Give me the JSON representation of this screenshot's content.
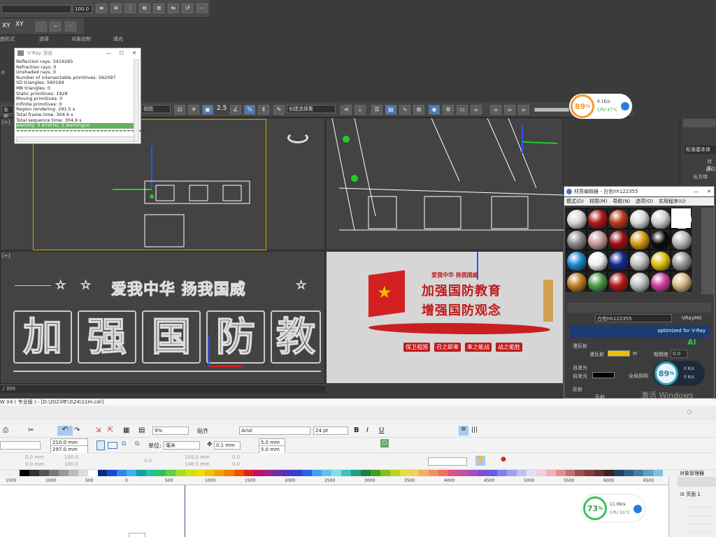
{
  "max": {
    "top_combo_value": "",
    "top_num": "100.0",
    "xy_label": "XY",
    "xy2_label": "XY",
    "row3_labels": [
      "曲形式",
      "选择",
      "对象绘制",
      "填充"
    ],
    "viewport_combo": "视图",
    "percent_num": "2.5",
    "selection_set": "创建选择集",
    "left_zero": "0",
    "full_label": "全部",
    "frame_counter": "/ 300",
    "viewport_left_labels": [
      "[+]",
      "[+]"
    ],
    "china_text": "爱我中华 扬我国威",
    "big_chars": [
      "加",
      "强",
      "国",
      "防",
      "教"
    ],
    "right_panel": {
      "std_label": "标准基本体",
      "obj_label": "对象",
      "auto_label": "自动",
      "box_label": "长方体"
    }
  },
  "vray": {
    "title": "V-Ray 消息",
    "lines": [
      "Reflection rays: 3419265",
      "Refraction rays: 0",
      "Unshaded rays: 0",
      "Number of intersectable primitives: 562097",
      "SD triangles: 560169",
      "MB triangles: 0",
      "Static primitives: 1928",
      "Moving primitives: 0",
      "Infinite primitives: 0",
      "Region rendering: 291.5 s",
      "Total frame time: 304.6 s",
      "Total sequence time: 304.9 s"
    ],
    "warning": "warning: 0 error(s), 2 warning(s)",
    "separator": "=================================="
  },
  "mat_editor": {
    "title": "材质编辑器 - 白色hh122355",
    "menu": [
      "模式(D)",
      "材质(M)",
      "导航(N)",
      "选项(O)",
      "实用程序(U)"
    ],
    "mat_name": "白色hh122355",
    "mat_type": "VRayMtl",
    "vray_banner": "optimized for V-Ray",
    "diffuse_section": "漫反射",
    "diffuse_label": "漫反射",
    "roughness_label": "粗糙度",
    "roughness_val": "0.0",
    "self_illum_section": "自发光",
    "self_illum_label": "自发光",
    "gi_label": "全局照明",
    "reflect_section": "反射",
    "reflect_label": "反射",
    "activate": "激活 Windows",
    "spheres": [
      "#d8d8d8",
      "#b01818",
      "#b83a1a",
      "#d8d8d8",
      "#d0d0d0",
      "#ffffff",
      "#8a8a8a",
      "#c89a9a",
      "#a01010",
      "#d89a10",
      "#0a0a0a",
      "#b8b8b8",
      "#1a8ad0",
      "#f0f0f0",
      "#102a90",
      "#c0c0c0",
      "#e0c010",
      "#9a9a9a",
      "#c08020",
      "#4a9a4a",
      "#b81818",
      "#c0c0c0",
      "#d040a0",
      "#d8b880"
    ],
    "ai_badge": "AI"
  },
  "monitor_top": {
    "percent": "89",
    "unit": "%",
    "net": "9.1K/s",
    "cpu": "CPU 47°C"
  },
  "monitor_mid": {
    "percent": "89",
    "unit": "%",
    "up": "0 K/s",
    "down": "0 K/s"
  },
  "monitor_bot": {
    "percent": "73",
    "unit": "%",
    "net": "11.0K/s",
    "cpu": "CPU 55°C"
  },
  "render": {
    "slogan_small": "爱我中华 扬我国威",
    "line1": "加强国防教育",
    "line2": "增强国防观念",
    "tags": [
      "保卫祖国",
      "召之即来",
      "来之能战",
      "战之能胜"
    ]
  },
  "corel": {
    "title": "W X4 ( 专业版 ) - [D:\\2023年\\3\\24\\11m.cdr]",
    "zoom": "9%",
    "paste_label": "贴齐",
    "font": "Arial",
    "font_size": "24 pt",
    "width": "210.0 mm",
    "height": "297.0 mm",
    "unit_label": "单位:",
    "unit": "毫米",
    "nudge": "0.1 mm",
    "dup_x": "5.0 mm",
    "dup_y": "5.0 mm",
    "pos_x": "0.0 mm",
    "pos_y": "0.0 mm",
    "scale_x": "100.0",
    "scale_y": "100.0",
    "angle": "0.0",
    "size2_x": "105.0 mm",
    "size2_y": "148.5 mm",
    "small0a": "0.0",
    "small0b": "0.0",
    "obj_manager": "对象管理器",
    "page1": "页面 1",
    "ruler": [
      "1500",
      "1000",
      "500",
      "0",
      "500",
      "1000",
      "1500",
      "2000",
      "2500",
      "3000",
      "3500",
      "4000",
      "4500",
      "5000",
      "5500",
      "6000",
      "6500"
    ]
  },
  "palette": [
    "#000000",
    "#333333",
    "#555555",
    "#777777",
    "#999999",
    "#bbbbbb",
    "#dddddd",
    "#ffffff",
    "#0a2a8a",
    "#1a4ad0",
    "#2a8ae0",
    "#40b0f0",
    "#10a0a0",
    "#20c0a0",
    "#30c060",
    "#60d040",
    "#a0e020",
    "#d0e010",
    "#f0e000",
    "#f0c000",
    "#f0a000",
    "#f08000",
    "#f05000",
    "#e02020",
    "#c01060",
    "#a02090",
    "#7030a0",
    "#5030c0",
    "#3040d0",
    "#3060e0",
    "#40a0f0",
    "#60c0f0",
    "#80e0e0",
    "#40c0c0",
    "#20a080",
    "#208040",
    "#40a020",
    "#80c020",
    "#c0d020",
    "#e0e040",
    "#f0d060",
    "#f0b060",
    "#f09060",
    "#f07060",
    "#e05080",
    "#c050a0",
    "#a050c0",
    "#8050d0",
    "#6060e0",
    "#8080f0",
    "#a0a0f0",
    "#c0c0f0",
    "#e0e0f8",
    "#f0d0e0",
    "#f0b0c0",
    "#e09090",
    "#c07070",
    "#a05050",
    "#804040",
    "#603030",
    "#402020",
    "#204060",
    "#306080",
    "#4080a0",
    "#60a0c0",
    "#80c0e0"
  ]
}
